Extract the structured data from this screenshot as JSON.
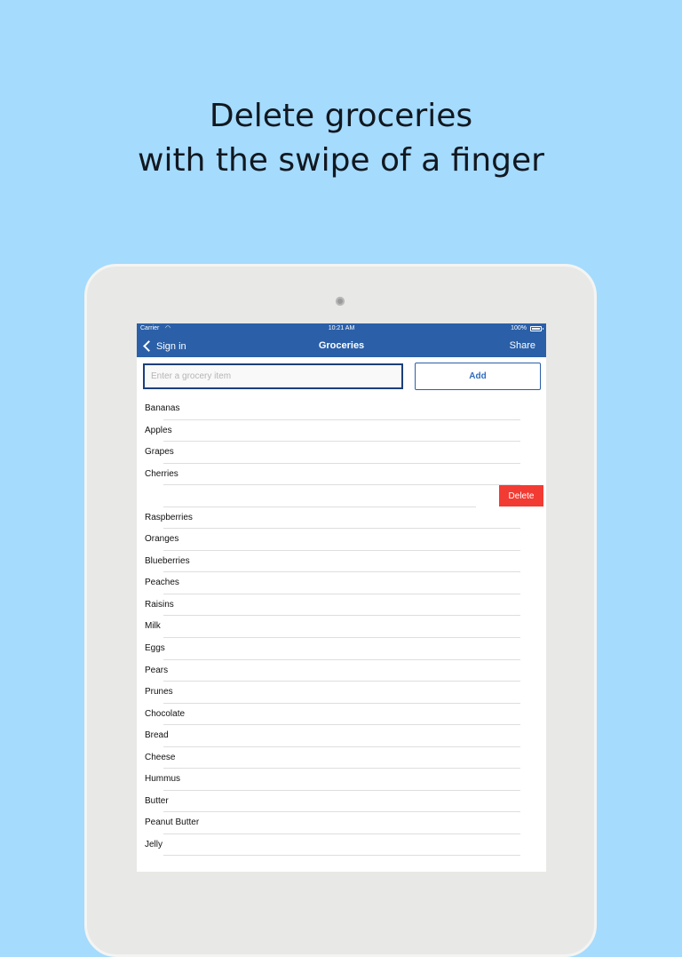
{
  "headline": {
    "line1": "Delete groceries",
    "line2": "with the swipe of a finger"
  },
  "status_bar": {
    "carrier": "Carrier",
    "time": "10:21 AM",
    "battery": "100%"
  },
  "nav": {
    "back_label": "Sign in",
    "title": "Groceries",
    "share_label": "Share"
  },
  "input": {
    "placeholder": "Enter a grocery item",
    "value": ""
  },
  "add_button_label": "Add",
  "delete_button_label": "Delete",
  "items": [
    "Bananas",
    "Apples",
    "Grapes",
    "Cherries",
    "",
    "Raspberries",
    "Oranges",
    "Blueberries",
    "Peaches",
    "Raisins",
    "Milk",
    "Eggs",
    "Pears",
    "Prunes",
    "Chocolate",
    "Bread",
    "Cheese",
    "Hummus",
    "Butter",
    "Peanut Butter",
    "Jelly"
  ],
  "swiped_row_index": 4,
  "colors": {
    "background": "#a5dbfd",
    "nav": "#2b60a8",
    "delete": "#f23b33",
    "accent": "#2f6cc0"
  }
}
